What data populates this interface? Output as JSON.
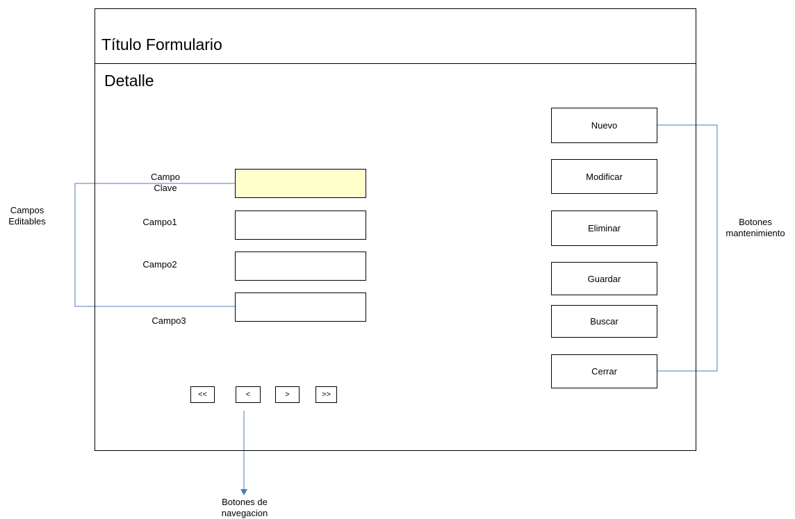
{
  "form": {
    "title": "Título Formulario",
    "section": "Detalle"
  },
  "fields": [
    {
      "label_line1": "Campo",
      "label_line2": "Clave",
      "value": "",
      "highlight": "#ffffcc"
    },
    {
      "label": "Campo1",
      "value": ""
    },
    {
      "label": "Campo2",
      "value": ""
    },
    {
      "label": "Campo3",
      "value": ""
    }
  ],
  "actions": [
    "Nuevo",
    "Modificar",
    "Eliminar",
    "Guardar",
    "Buscar",
    "Cerrar"
  ],
  "navigation": [
    "<<",
    "<",
    ">",
    ">>"
  ],
  "annotations": {
    "editable_fields": {
      "line1": "Campos",
      "line2": "Editables"
    },
    "maintenance_buttons": {
      "line1": "Botones",
      "line2": "mantenimiento"
    },
    "navigation_buttons": {
      "line1": "Botones de",
      "line2": "navegacion"
    }
  },
  "colors": {
    "connector": "#4a7ebb",
    "key_field": "#ffffcc"
  }
}
